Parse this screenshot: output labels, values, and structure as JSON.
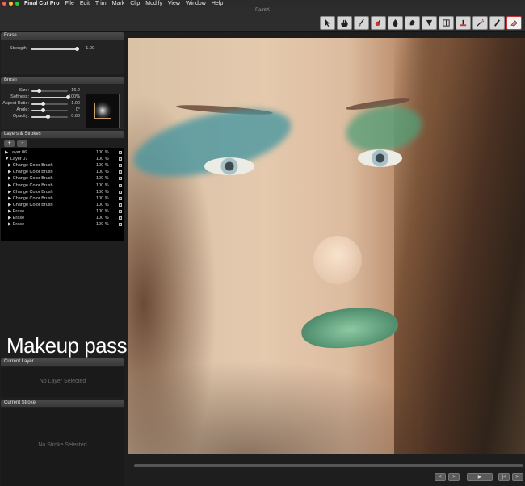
{
  "menubar": {
    "app": "Final Cut Pro",
    "items": [
      "File",
      "Edit",
      "Trim",
      "Mark",
      "Clip",
      "Modify",
      "View",
      "Window",
      "Help"
    ]
  },
  "window": {
    "title": "PaintX"
  },
  "toolbar": {
    "tools": [
      "select-arrow",
      "hand",
      "brush",
      "color-brush",
      "drop",
      "smudge",
      "cone",
      "grid",
      "eraser-bucket",
      "magic-wand",
      "pencil",
      "eraser"
    ]
  },
  "erase_panel": {
    "title": "Erase",
    "strength_label": "Strength:",
    "strength_value": "1.00",
    "strength_fraction": 1.0
  },
  "brush_panel": {
    "title": "Brush",
    "params": [
      {
        "label": "Size:",
        "value": "16.2",
        "fraction": 0.2
      },
      {
        "label": "Softness:",
        "value": "100%",
        "fraction": 1.0
      },
      {
        "label": "Aspect Ratio:",
        "value": "1.00",
        "fraction": 0.3
      },
      {
        "label": "Angle:",
        "value": "0°",
        "fraction": 0.3
      },
      {
        "label": "Opacity:",
        "value": "0.60",
        "fraction": 0.45
      }
    ]
  },
  "layers_panel": {
    "title": "Layers & Strokes",
    "add_label": "+",
    "remove_label": "-",
    "rows": [
      {
        "name": "▶ Layer 06",
        "pct": "100 %",
        "indent": 0
      },
      {
        "name": "▼ Layer 07",
        "pct": "100 %",
        "indent": 0
      },
      {
        "name": "▶ Change Color Brush",
        "pct": "100 %",
        "indent": 1
      },
      {
        "name": "▶ Change Color Brush",
        "pct": "100 %",
        "indent": 1
      },
      {
        "name": "▶ Change Color Brush",
        "pct": "100 %",
        "indent": 1
      },
      {
        "name": "▶ Change Color Brush",
        "pct": "100 %",
        "indent": 1
      },
      {
        "name": "▶ Change Color Brush",
        "pct": "100 %",
        "indent": 1
      },
      {
        "name": "▶ Change Color Brush",
        "pct": "100 %",
        "indent": 1
      },
      {
        "name": "▶ Change Color Brush",
        "pct": "100 %",
        "indent": 1
      },
      {
        "name": "▶ Erase",
        "pct": "100 %",
        "indent": 1
      },
      {
        "name": "▶ Erase",
        "pct": "100 %",
        "indent": 1
      },
      {
        "name": "▶ Erase",
        "pct": "100 %",
        "indent": 1
      }
    ]
  },
  "caption": "Makeup pass",
  "current_layer_panel": {
    "title": "Current Layer",
    "empty_text": "No Layer Selected"
  },
  "current_stroke_panel": {
    "title": "Current Stroke",
    "empty_text": "No Stroke Selected"
  },
  "timeline": {
    "prev_label": "<",
    "next_label": ">",
    "play_label": "▶",
    "start_label": "|<",
    "end_label": ">|"
  },
  "colors": {
    "eyeshadow": "#4f9a9e",
    "lipstick": "#6fae8c",
    "accent_red": "#cc3333"
  }
}
